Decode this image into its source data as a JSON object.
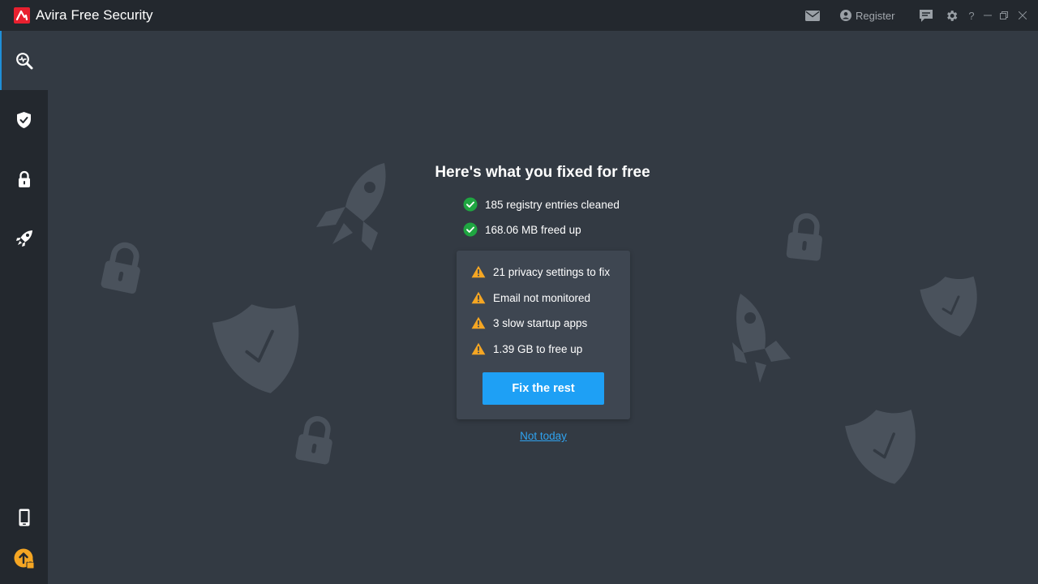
{
  "app": {
    "brand": "Avira",
    "product": "Free Security",
    "accent_color": "#e8202f"
  },
  "titlebar": {
    "register_label": "Register",
    "help_label": "?",
    "icons": [
      "mail-icon",
      "user-icon",
      "feedback-icon",
      "gear-icon",
      "help-icon",
      "minimize-icon",
      "restore-icon",
      "close-icon"
    ]
  },
  "sidebar": {
    "items": [
      {
        "name": "scan",
        "icon": "scan-icon",
        "active": true
      },
      {
        "name": "security",
        "icon": "shield-icon",
        "active": false
      },
      {
        "name": "privacy",
        "icon": "lock-icon",
        "active": false
      },
      {
        "name": "performance",
        "icon": "rocket-icon",
        "active": false
      },
      {
        "name": "mobile",
        "icon": "mobile-icon",
        "active": false
      },
      {
        "name": "upgrade",
        "icon": "upgrade-icon",
        "active": false
      }
    ]
  },
  "main": {
    "heading": "Here's what you fixed for free",
    "fixed": [
      {
        "text": "185 registry entries cleaned",
        "status": "ok"
      },
      {
        "text": "168.06 MB freed up",
        "status": "ok"
      }
    ],
    "remaining": [
      {
        "text": "21 privacy settings to fix",
        "status": "warning"
      },
      {
        "text": "Email not monitored",
        "status": "warning"
      },
      {
        "text": "3 slow startup apps",
        "status": "warning"
      },
      {
        "text": "1.39 GB to free up",
        "status": "warning"
      }
    ],
    "fix_button": "Fix the rest",
    "dismiss_link": "Not today"
  },
  "colors": {
    "ok": "#1fa641",
    "warning": "#f5a623",
    "button": "#1ea0f5",
    "link": "#2fa3f0"
  }
}
